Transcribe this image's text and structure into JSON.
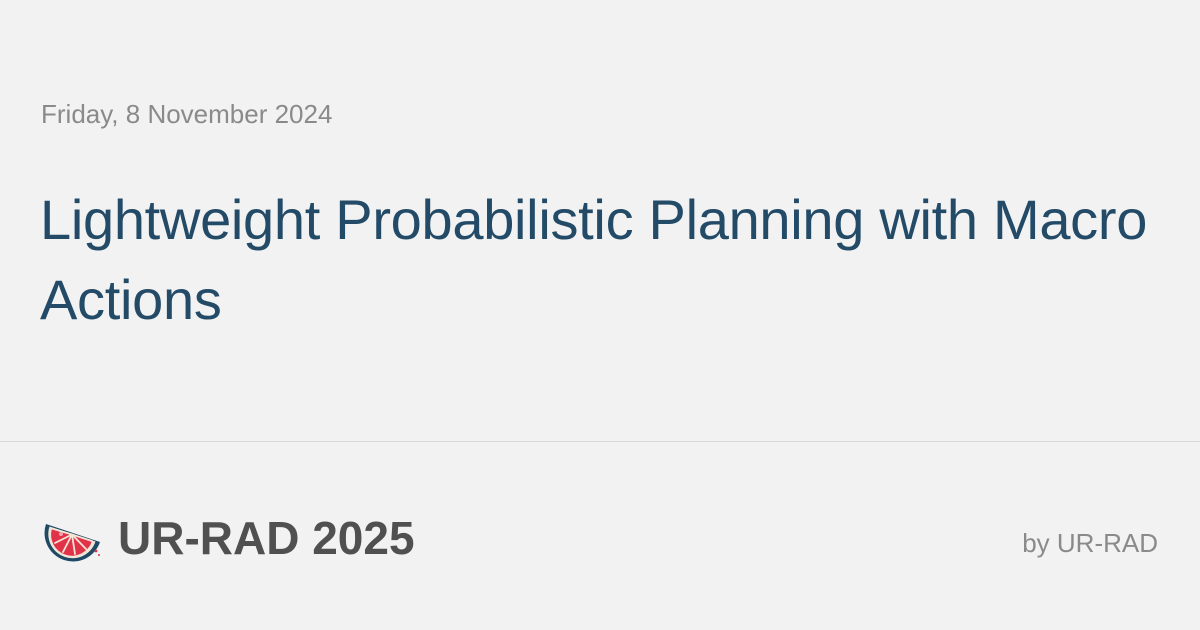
{
  "post": {
    "date": "Friday, 8 November 2024",
    "title": "Lightweight Probabilistic Planning with Macro Actions"
  },
  "footer": {
    "logo_icon": "grapefruit-slice-icon",
    "site_name": "UR-RAD 2025",
    "byline": "by UR-RAD"
  },
  "colors": {
    "background": "#f2f2f2",
    "title": "#234b68",
    "muted_text": "#8a8a8a",
    "brand_text": "#505050",
    "logo_flesh": "#e0334a",
    "logo_rind": "#1f4a66"
  }
}
